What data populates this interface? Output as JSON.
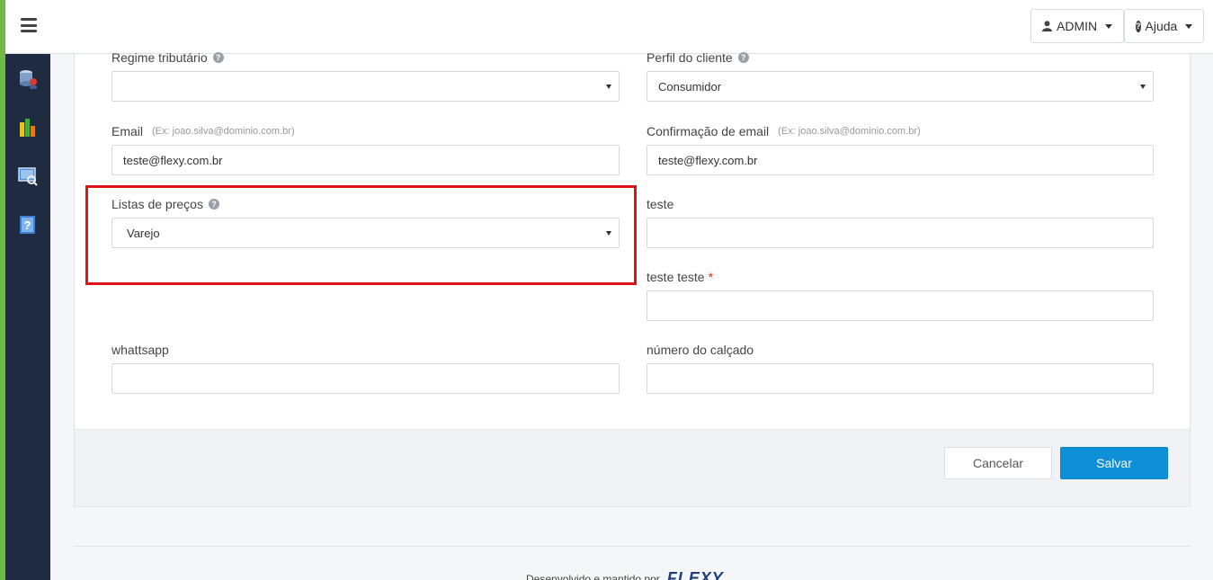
{
  "header": {
    "user_button_label": "ADMIN",
    "help_button_label": "Ajuda"
  },
  "sidebar": {
    "items": [
      {
        "icon": "database-user-icon"
      },
      {
        "icon": "bar-chart-icon"
      },
      {
        "icon": "monitor-search-icon"
      },
      {
        "icon": "help-book-icon"
      }
    ]
  },
  "form": {
    "regime_tributario": {
      "label": "Regime tributário",
      "value": ""
    },
    "perfil_cliente": {
      "label": "Perfil do cliente",
      "value": "Consumidor"
    },
    "email": {
      "label": "Email",
      "hint": "(Ex: joao.silva@dominio.com.br)",
      "value": "teste@flexy.com.br"
    },
    "email_confirm": {
      "label": "Confirmação de email",
      "hint": "(Ex: joao.silva@dominio.com.br)",
      "value": "teste@flexy.com.br"
    },
    "listas_precos": {
      "label": "Listas de preços",
      "value": "Varejo"
    },
    "teste": {
      "label": "teste",
      "value": ""
    },
    "teste_teste": {
      "label": "teste teste",
      "required_mark": "*",
      "value": ""
    },
    "whattsapp": {
      "label": "whattsapp",
      "value": ""
    },
    "numero_calcado": {
      "label": "número do calçado",
      "value": ""
    }
  },
  "actions": {
    "cancel_label": "Cancelar",
    "save_label": "Salvar"
  },
  "footer": {
    "text": "Desenvolvido e mantido por",
    "brand": "FLEXY"
  },
  "colors": {
    "accent": "#0f8fd8",
    "sidebar": "#1f2b40",
    "strip": "#6dbb45",
    "highlight": "#e01418"
  }
}
